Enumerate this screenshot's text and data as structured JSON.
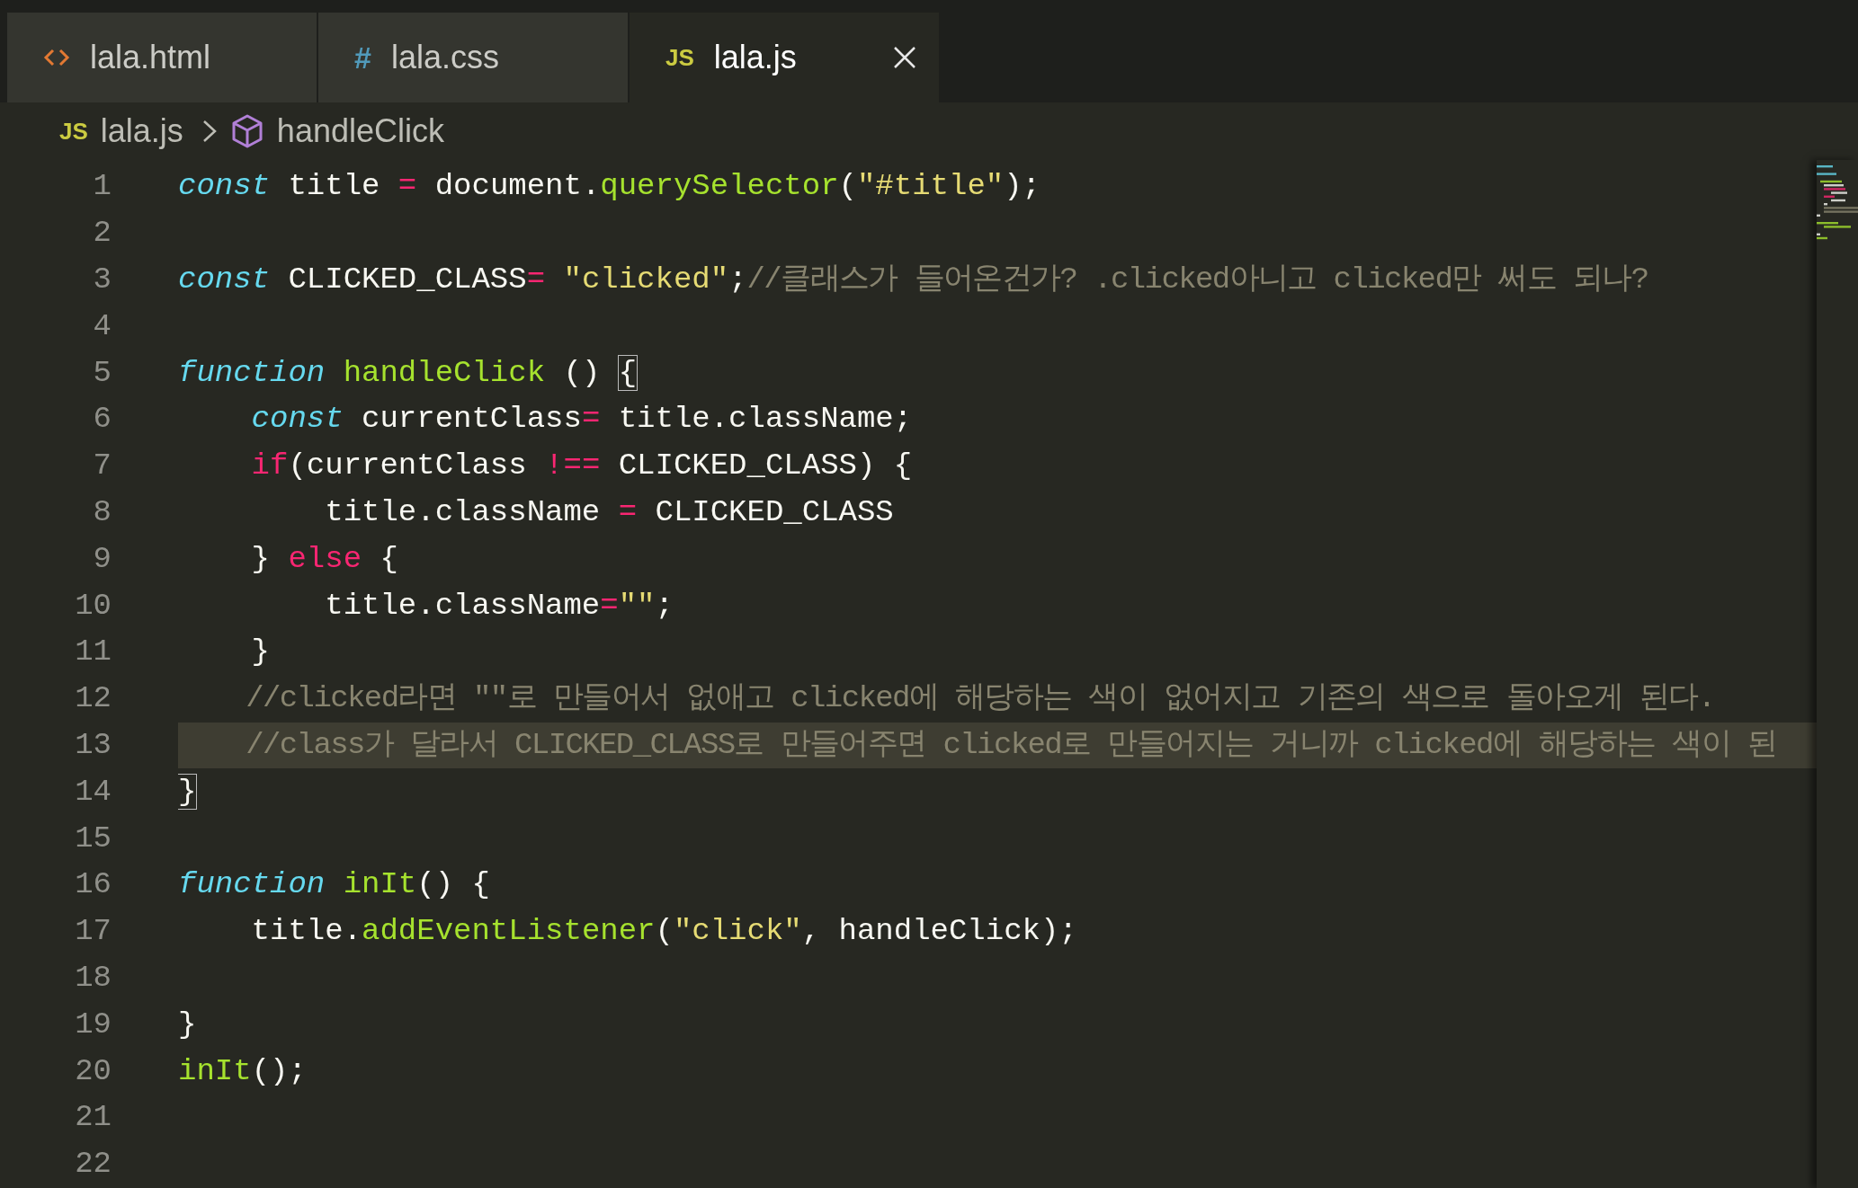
{
  "tabs": [
    {
      "label": "lala.html",
      "kind": "html",
      "selected": false
    },
    {
      "label": "lala.css",
      "kind": "css",
      "icon_text": "#",
      "selected": false
    },
    {
      "label": "lala.js",
      "kind": "js",
      "icon_text": "JS",
      "selected": true
    }
  ],
  "breadcrumbs": [
    {
      "kind": "file",
      "icon_text": "JS",
      "label": "lala.js"
    },
    {
      "kind": "symbol",
      "label": "handleClick"
    }
  ],
  "lines": [
    {
      "number": "1",
      "highlighted": false,
      "tokens": [
        {
          "kind": "keyword",
          "text": "const"
        },
        {
          "kind": "plain",
          "text": " title "
        },
        {
          "kind": "operator",
          "text": "="
        },
        {
          "kind": "plain",
          "text": " document."
        },
        {
          "kind": "function",
          "text": "querySelector"
        },
        {
          "kind": "plain",
          "text": "("
        },
        {
          "kind": "string",
          "text": "\"#title\""
        },
        {
          "kind": "plain",
          "text": ");"
        }
      ]
    },
    {
      "number": "2",
      "highlighted": false
    },
    {
      "number": "3",
      "highlighted": false,
      "tokens": [
        {
          "kind": "keyword",
          "text": "const"
        },
        {
          "kind": "plain",
          "text": " CLICKED_CLASS"
        },
        {
          "kind": "operator",
          "text": "="
        },
        {
          "kind": "string",
          "text": " \"clicked\""
        },
        {
          "kind": "plain",
          "text": ";"
        },
        {
          "kind": "comment",
          "text": "//클래스가 들어온건가? .clicked아니고 clicked만 써도 되나?"
        }
      ]
    },
    {
      "number": "4",
      "highlighted": false
    },
    {
      "number": "5",
      "highlighted": false,
      "tokens": [
        {
          "kind": "keyword",
          "text": "function"
        },
        {
          "kind": "function",
          "text": " handleClick"
        },
        {
          "kind": "plain",
          "text": " () "
        },
        {
          "kind": "plain",
          "text": "{",
          "bracket_match": true
        }
      ]
    },
    {
      "number": "6",
      "highlighted": false,
      "tokens": [
        {
          "kind": "keyword",
          "text": "    const"
        },
        {
          "kind": "plain",
          "text": " currentClass"
        },
        {
          "kind": "operator",
          "text": "="
        },
        {
          "kind": "plain",
          "text": " title.className;"
        }
      ]
    },
    {
      "number": "7",
      "highlighted": false,
      "tokens": [
        {
          "kind": "operator",
          "text": "    if"
        },
        {
          "kind": "plain",
          "text": "(currentClass "
        },
        {
          "kind": "operator",
          "text": "!=="
        },
        {
          "kind": "plain",
          "text": " CLICKED_CLASS) {"
        }
      ]
    },
    {
      "number": "8",
      "highlighted": false,
      "tokens": [
        {
          "kind": "plain",
          "text": "        title.className "
        },
        {
          "kind": "operator",
          "text": "="
        },
        {
          "kind": "plain",
          "text": " CLICKED_CLASS"
        }
      ]
    },
    {
      "number": "9",
      "highlighted": false,
      "tokens": [
        {
          "kind": "plain",
          "text": "    } "
        },
        {
          "kind": "operator",
          "text": "else"
        },
        {
          "kind": "plain",
          "text": " {"
        }
      ]
    },
    {
      "number": "10",
      "highlighted": false,
      "tokens": [
        {
          "kind": "plain",
          "text": "        title.className"
        },
        {
          "kind": "operator",
          "text": "="
        },
        {
          "kind": "string",
          "text": "\"\""
        },
        {
          "kind": "plain",
          "text": ";"
        }
      ]
    },
    {
      "number": "11",
      "highlighted": false,
      "tokens": [
        {
          "kind": "plain",
          "text": "    }"
        }
      ]
    },
    {
      "number": "12",
      "highlighted": false,
      "tokens": [
        {
          "kind": "comment",
          "text": "    //clicked라면 \"\"로 만들어서 없애고 clicked에 해당하는 색이 없어지고 기존의 색으로 돌아오게 된다."
        }
      ]
    },
    {
      "number": "13",
      "highlighted": true,
      "tokens": [
        {
          "kind": "comment",
          "text": "    //class가 달라서 CLICKED_CLASS로 만들어주면 clicked로 만들어지는 거니까 clicked에 해당하는 색이 된"
        }
      ]
    },
    {
      "number": "14",
      "highlighted": false,
      "tokens": [
        {
          "kind": "plain",
          "text": "}",
          "bracket_match": true
        }
      ]
    },
    {
      "number": "15",
      "highlighted": false
    },
    {
      "number": "16",
      "highlighted": false,
      "tokens": [
        {
          "kind": "keyword",
          "text": "function"
        },
        {
          "kind": "function",
          "text": " inIt"
        },
        {
          "kind": "plain",
          "text": "() {"
        }
      ]
    },
    {
      "number": "17",
      "highlighted": false,
      "tokens": [
        {
          "kind": "plain",
          "text": "    title."
        },
        {
          "kind": "function",
          "text": "addEventListener"
        },
        {
          "kind": "plain",
          "text": "("
        },
        {
          "kind": "string",
          "text": "\"click\""
        },
        {
          "kind": "plain",
          "text": ", handleClick);"
        }
      ]
    },
    {
      "number": "18",
      "highlighted": false
    },
    {
      "number": "19",
      "highlighted": false,
      "tokens": [
        {
          "kind": "plain",
          "text": "}"
        }
      ]
    },
    {
      "number": "20",
      "highlighted": false,
      "tokens": [
        {
          "kind": "function",
          "text": "inIt"
        },
        {
          "kind": "plain",
          "text": "();"
        }
      ]
    },
    {
      "number": "21",
      "highlighted": false
    },
    {
      "number": "22",
      "highlighted": false
    }
  ]
}
